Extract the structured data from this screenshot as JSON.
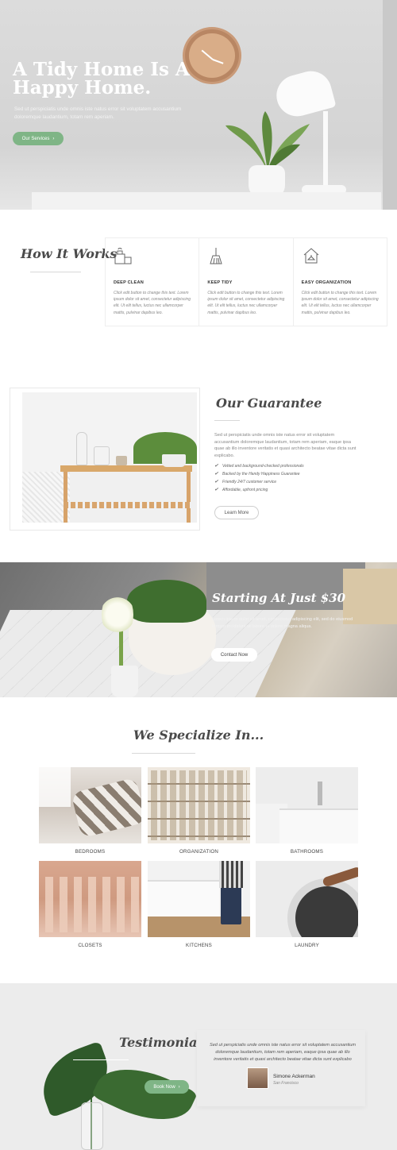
{
  "hero": {
    "title": "A Tidy Home Is A Happy Home.",
    "text": "Sed ut perspiciatis unde omnis iste natus error sit voluptatem accusantium doloremque laudantium, totam rem aperiam.",
    "button_label": "Our Services",
    "button_arrow": "›"
  },
  "how_it_works": {
    "title": "How It Works",
    "cards": [
      {
        "icon": "cleaning-bucket-icon",
        "title": "DEEP CLEAN",
        "text": "Click edit button to change this text. Lorem ipsum dolor sit amet, consectetur adipiscing elit. Ut elit tellus, luctus nec ullamcorper mattis, pulvinar dapibus leo."
      },
      {
        "icon": "broom-icon",
        "title": "KEEP TIDY",
        "text": "Click edit button to change this text. Lorem ipsum dolor sit amet, consectetur adipiscing elit. Ut elit tellus, luctus nec ullamcorper mattis, pulvinar dapibus leo."
      },
      {
        "icon": "hanger-house-icon",
        "title": "EASY ORGANIZATION",
        "text": "Click edit button to change this text. Lorem ipsum dolor sit amet, consectetur adipiscing elit. Ut elit tellus, luctus nec ullamcorper mattis, pulvinar dapibus leo."
      }
    ]
  },
  "guarantee": {
    "title": "Our Guarantee",
    "text": "Sed ut perspiciatis unde omnis iste natus error sit voluptatem accusantium doloremque laudantium, totam rem aperiam, eaque ipsa quae ab illo inventore veritatis et quasi architecto beatae vitae dicta sunt explicabo.",
    "items": [
      "Vetted and background-checked professionals",
      "Backed by the Handy Happiness Guarantee",
      "Friendly 24/7 customer service",
      "Affordable, upfront pricing"
    ],
    "button_label": "Learn More"
  },
  "pricing": {
    "title": "Starting At Just $30",
    "text": "Lorem ipsum dolor sit amet, consectetur adipiscing elit, sed do eiusmod tempor incididunt ut labore et dolore magna aliqua.",
    "button_label": "Contact Now"
  },
  "specialize": {
    "title": "We Specialize In...",
    "tiles": [
      "BEDROOMS",
      "ORGANIZATION",
      "BATHROOMS",
      "CLOSETS",
      "KITCHENS",
      "LAUNDRY"
    ]
  },
  "testimonials": {
    "title": "Testimonials",
    "quote": "Sed ut perspiciatis unde omnis iste natus error sit voluptatem accusantium doloremque laudantium, totam rem aperiam, eaque ipsa quae ab illo inventore veritatis et quasi architecto beatae vitae dicta sunt explicabo",
    "name": "Simone Ackerman",
    "location": "San Francisco",
    "button_label": "Book Now",
    "button_arrow": "›"
  },
  "colors": {
    "accent_green": "#7fb586",
    "heading": "#4a4a4a"
  }
}
